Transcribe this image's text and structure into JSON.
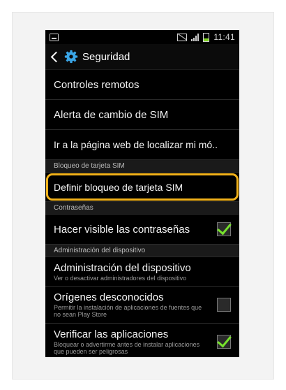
{
  "status_bar": {
    "time": "11:41",
    "battery_color": "#7ed321"
  },
  "action_bar": {
    "title": "Seguridad",
    "accent": "#3aa5e6"
  },
  "items": [
    {
      "type": "item",
      "title": "Controles remotos"
    },
    {
      "type": "item",
      "title": "Alerta de cambio de SIM"
    },
    {
      "type": "item",
      "title": "Ir a la página web de localizar mi mó.."
    },
    {
      "type": "header",
      "title": "Bloqueo de tarjeta SIM"
    },
    {
      "type": "item",
      "title": "Definir bloqueo de tarjeta SIM",
      "highlighted": true
    },
    {
      "type": "header",
      "title": "Contraseñas"
    },
    {
      "type": "item",
      "title": "Hacer visible las contraseñas",
      "checked": true
    },
    {
      "type": "header",
      "title": "Administración del dispositivo"
    },
    {
      "type": "item",
      "title": "Administración del dispositivo",
      "subtitle": "Ver o desactivar administradores del dispositivo"
    },
    {
      "type": "item",
      "title": "Orígenes desconocidos",
      "subtitle": "Permitir la instalación de aplicaciones de fuentes que no sean Play Store",
      "checked": false
    },
    {
      "type": "item",
      "title": "Verificar las aplicaciones",
      "subtitle": "Bloquear o advertirme antes de instalar aplicaciones que pueden ser peligrosas",
      "checked": true
    }
  ],
  "highlight_color": "#f2b21a",
  "check_color": "#76e12c"
}
